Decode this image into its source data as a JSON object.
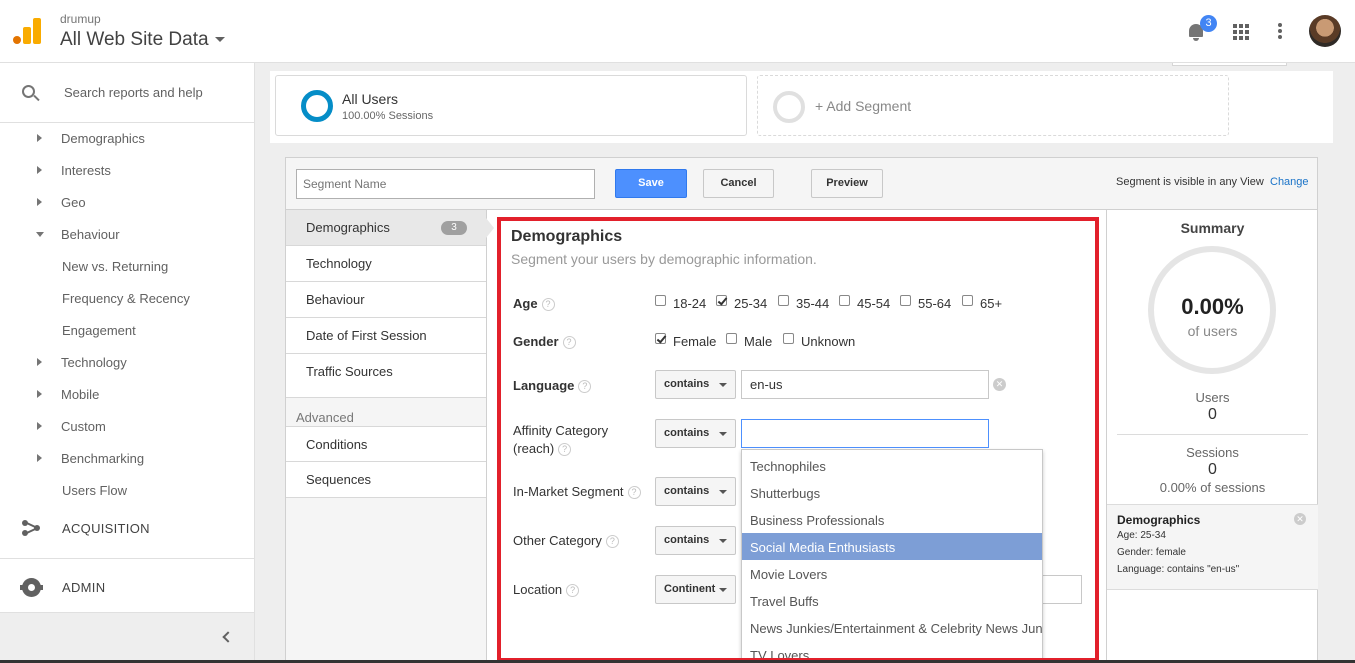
{
  "header": {
    "account": "drumup",
    "property": "All Web Site Data",
    "notification_count": "3"
  },
  "sidebar": {
    "search_placeholder": "Search reports and help",
    "items": [
      {
        "label": "Demographics",
        "arrow": "right"
      },
      {
        "label": "Interests",
        "arrow": "right"
      },
      {
        "label": "Geo",
        "arrow": "right"
      },
      {
        "label": "Behaviour",
        "arrow": "down"
      },
      {
        "label": "New vs. Returning",
        "arrow": "none"
      },
      {
        "label": "Frequency & Recency",
        "arrow": "none"
      },
      {
        "label": "Engagement",
        "arrow": "none"
      },
      {
        "label": "Technology",
        "arrow": "right"
      },
      {
        "label": "Mobile",
        "arrow": "right"
      },
      {
        "label": "Custom",
        "arrow": "right"
      },
      {
        "label": "Benchmarking",
        "arrow": "right"
      },
      {
        "label": "Users Flow",
        "arrow": "none"
      }
    ],
    "acquisition": "ACQUISITION",
    "admin": "ADMIN"
  },
  "segments": {
    "all_users_title": "All Users",
    "all_users_sub": "100.00% Sessions",
    "add_segment": "+ Add Segment"
  },
  "editor": {
    "segment_name_placeholder": "Segment Name",
    "save": "Save",
    "cancel": "Cancel",
    "preview": "Preview",
    "visibility": "Segment is visible in any View",
    "change": "Change",
    "menu": [
      {
        "label": "Demographics",
        "count": "3"
      },
      {
        "label": "Technology"
      },
      {
        "label": "Behaviour"
      },
      {
        "label": "Date of First Session"
      },
      {
        "label": "Traffic Sources"
      }
    ],
    "advanced_heading": "Advanced",
    "advanced": [
      {
        "label": "Conditions"
      },
      {
        "label": "Sequences"
      }
    ]
  },
  "demographics": {
    "title": "Demographics",
    "subtitle": "Segment your users by demographic information.",
    "age_label": "Age",
    "age_options": [
      {
        "label": "18-24",
        "checked": false
      },
      {
        "label": "25-34",
        "checked": true
      },
      {
        "label": "35-44",
        "checked": false
      },
      {
        "label": "45-54",
        "checked": false
      },
      {
        "label": "55-64",
        "checked": false
      },
      {
        "label": "65+",
        "checked": false
      }
    ],
    "gender_label": "Gender",
    "gender_options": [
      {
        "label": "Female",
        "checked": true
      },
      {
        "label": "Male",
        "checked": false
      },
      {
        "label": "Unknown",
        "checked": false
      }
    ],
    "language_label": "Language",
    "language_op": "contains",
    "language_value": "en-us",
    "affinity_label_1": "Affinity Category",
    "affinity_label_2": "(reach)",
    "affinity_op": "contains",
    "affinity_value": "",
    "inmarket_label": "In-Market Segment",
    "inmarket_op": "contains",
    "other_label": "Other Category",
    "other_op": "contains",
    "location_label": "Location",
    "location_op": "Continent",
    "dropdown": [
      "Technophiles",
      "Shutterbugs",
      "Business Professionals",
      "Social Media Enthusiasts",
      "Movie Lovers",
      "Travel Buffs",
      "News Junkies/Entertainment & Celebrity News Junkies",
      "TV Lovers"
    ],
    "dropdown_highlighted": "Social Media Enthusiasts"
  },
  "summary": {
    "title": "Summary",
    "percent": "0.00%",
    "of_users": "of users",
    "users_label": "Users",
    "users_value": "0",
    "sessions_label": "Sessions",
    "sessions_value": "0",
    "sessions_pct": "0.00% of sessions",
    "detail_title": "Demographics",
    "detail_age": "Age: 25-34",
    "detail_gender": "Gender: female",
    "detail_language": "Language: contains \"en-us\""
  },
  "colors": {
    "accent_blue": "#4d90fe",
    "highlight_box": "#e2202b",
    "segment_ring": "#058dc7",
    "dropdown_highlight": "#7d9ed6"
  }
}
